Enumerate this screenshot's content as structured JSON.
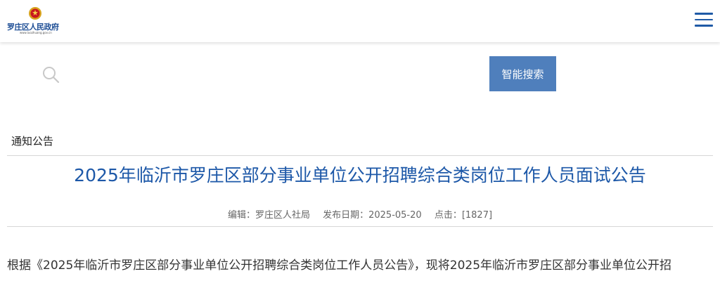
{
  "header": {
    "logo_text": "罗庄区人民政府",
    "logo_url": "www.luozhuang.gov.cn",
    "menu_icon": "hamburger-menu-icon"
  },
  "search": {
    "placeholder": "",
    "button_label": "智能搜索",
    "icon": "search-icon"
  },
  "breadcrumb": {
    "label": "通知公告"
  },
  "article": {
    "title": "2025年临沂市罗庄区部分事业单位公开招聘综合类岗位工作人员面试公告",
    "meta": {
      "editor": "编辑：罗庄区人社局",
      "date": "发布日期：2025-05-20",
      "clicks": "点击：[1827]"
    },
    "body_first_line": "根据《2025年临沂市罗庄区部分事业单位公开招聘综合类岗位工作人员公告》，现将2025年临沂市罗庄区部分事业单位公开招"
  },
  "colors": {
    "accent": "#1d58a8",
    "button": "#4f7fbc"
  }
}
